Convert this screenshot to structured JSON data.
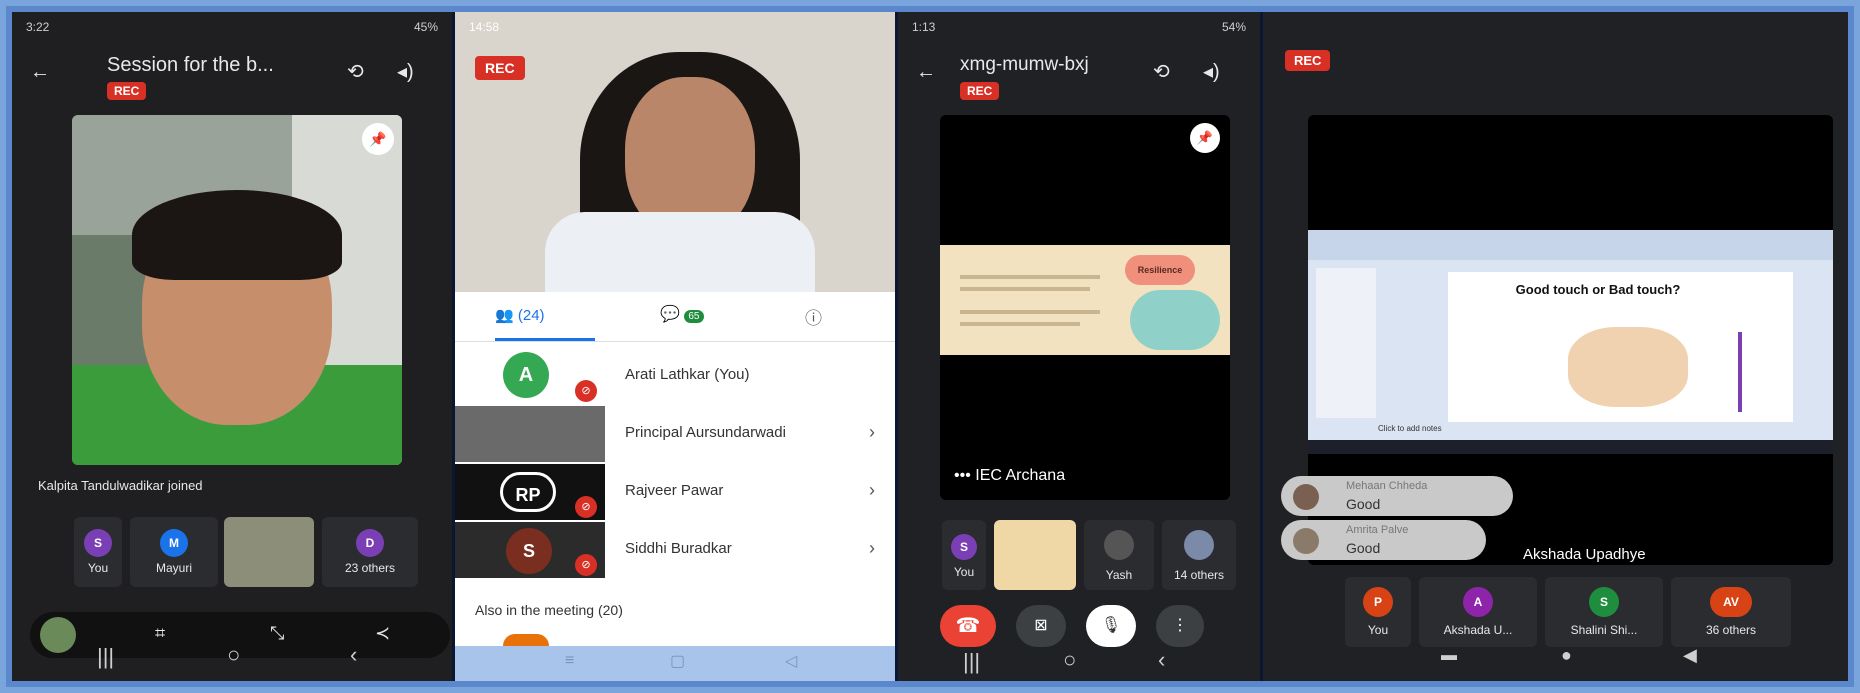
{
  "panel1": {
    "status": {
      "time": "3:22",
      "right": "45%"
    },
    "title": "Session for the b...",
    "rec": "REC",
    "join_message": "Kalpita Tandulwadikar joined",
    "tiles": [
      {
        "initial": "S",
        "label": "You",
        "color": "#7b3fb5"
      },
      {
        "initial": "M",
        "label": "Mayuri",
        "color": "#1a73e8"
      },
      {
        "initial": "D",
        "label": "23 others",
        "color": "#7b3fb5"
      }
    ],
    "accent": "#d93025"
  },
  "panel2": {
    "status": {
      "time": "14:58"
    },
    "rec": "REC",
    "tabs": {
      "people_count": "(24)",
      "chat_count": "65"
    },
    "participants": [
      {
        "initial": "A",
        "name": "Arati Lathkar (You)",
        "color": "#34a853",
        "muted": true
      },
      {
        "initial": "",
        "name": "Principal Aursundarwadi",
        "color": "#6a6a6a",
        "muted": false
      },
      {
        "initial": "RP",
        "name": "Rajveer Pawar",
        "color": "#111111",
        "muted": true
      },
      {
        "initial": "S",
        "name": "Siddhi Buradkar",
        "color": "#a0432f",
        "muted": true
      }
    ],
    "also_label": "Also in the meeting (20)"
  },
  "panel3": {
    "status": {
      "time": "1:13",
      "right": "54%"
    },
    "title": "xmg-mumw-bxj",
    "rec": "REC",
    "slide_title": "Resilience",
    "presenter": "IEC Archana",
    "tiles": [
      {
        "initial": "S",
        "label": "You",
        "color": "#7b3fb5"
      },
      {
        "initial": "",
        "label": "Yash",
        "color": "#444"
      },
      {
        "initial": "",
        "label": "14 others",
        "color": "#444"
      }
    ]
  },
  "panel4": {
    "rec": "REC",
    "slide_title": "Good touch or Bad touch?",
    "slide_footer": "Click to add notes",
    "chats": [
      {
        "name": "Mehaan Chheda",
        "message": "Good"
      },
      {
        "name": "Amrita Palve",
        "message": "Good"
      }
    ],
    "presenter": "Akshada Upadhye",
    "tiles": [
      {
        "initial": "P",
        "label": "You",
        "color": "#d84315"
      },
      {
        "initial": "A",
        "label": "Akshada U...",
        "color": "#8e24aa"
      },
      {
        "initial": "S",
        "label": "Shalini Shi...",
        "color": "#1e8e3e"
      },
      {
        "initial": "AV",
        "label": "36 others",
        "color": "#d84315"
      }
    ]
  }
}
